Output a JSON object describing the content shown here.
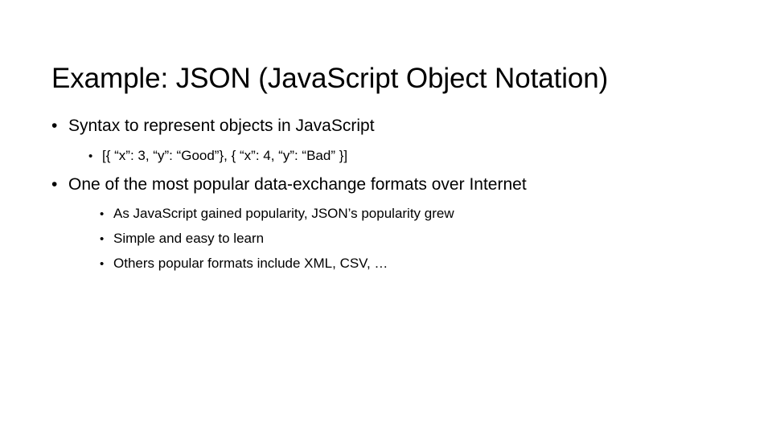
{
  "slide": {
    "background_color": "#ffffff",
    "text_color": "#000000",
    "title": "Example: JSON (JavaScript Object Notation)",
    "bullet_marker": "•",
    "content": [
      {
        "level": 1,
        "text": "Syntax to represent objects in JavaScript"
      },
      {
        "level": 2,
        "text": "[{ “x”: 3, “y”: “Good”}, { “x”: 4, “y”: “Bad” }]"
      },
      {
        "level": 1,
        "text": "One of the most popular data-exchange formats over Internet"
      },
      {
        "level": 2,
        "text": "As JavaScript gained popularity, JSON’s popularity grew"
      },
      {
        "level": 2,
        "text": "Simple and easy to learn"
      },
      {
        "level": 2,
        "text": "Others popular formats include XML, CSV, …"
      }
    ]
  }
}
